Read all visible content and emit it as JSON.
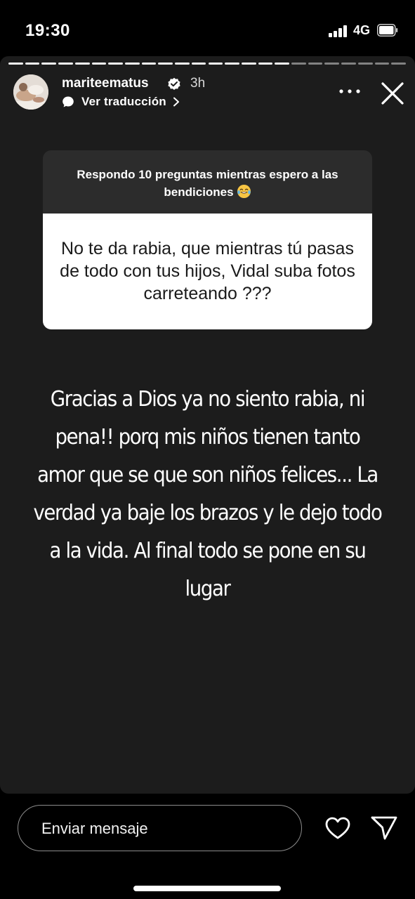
{
  "status_bar": {
    "time": "19:30",
    "network": "4G"
  },
  "story": {
    "progress": {
      "segments_total": 24,
      "segments_viewed": 17
    },
    "header": {
      "username": "mariteematus",
      "verified": true,
      "time_ago": "3h",
      "translate_label": "Ver traducción",
      "more_icon": "more-horizontal-icon",
      "close_icon": "close-icon"
    },
    "question": {
      "prompt": "Respondo 10 preguntas mientras espero a las bendiciones",
      "prompt_emoji": "laughing-tears-emoji",
      "text": "No te da rabia, que mientras tú pasas de todo con tus hijos, Vidal suba fotos carreteando ???"
    },
    "answer": "Gracias a Dios ya no siento rabia, ni pena!! porq mis niños tienen tanto amor que se que son niños felices... La verdad ya baje los brazos y le dejo todo a la vida. Al final todo se pone en su lugar"
  },
  "footer": {
    "message_placeholder": "Enviar mensaje",
    "like_icon": "heart-icon",
    "send_icon": "send-icon"
  },
  "colors": {
    "story_background": "#1c1c1c",
    "question_header": "#2c2c2c",
    "question_body": "#ffffff",
    "verified_badge": "#ffffff"
  }
}
